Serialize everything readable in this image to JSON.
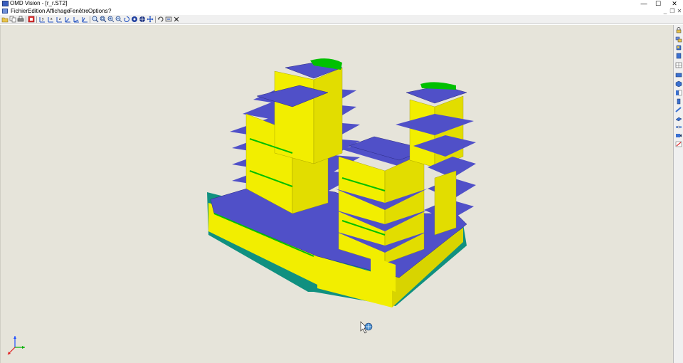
{
  "window": {
    "title": "OMD Vision - [r_r.ST2]",
    "controls": {
      "minimize": "—",
      "maximize": "☐",
      "close": "✕"
    }
  },
  "menu": {
    "items": [
      "Fichier",
      "Edition",
      "Affichage",
      "Fenêtre",
      "Options",
      "?"
    ],
    "mdi_controls": {
      "minimize": "_",
      "restore": "❐",
      "close": "✕"
    }
  },
  "toolbar": {
    "groups": [
      [
        "open-icon",
        "copy-icon",
        "print-icon"
      ],
      [
        "stop-icon"
      ],
      [
        "axis-y-icon",
        "axis-x-icon",
        "axis-z-icon",
        "axis-xy-icon",
        "axis-yz-icon",
        "axis-xz-icon"
      ],
      [
        "zoom-icon",
        "zoom-window-icon",
        "zoom-in-icon",
        "zoom-out-icon",
        "rotate-icon",
        "view-icon",
        "camera-icon",
        "move-icon"
      ],
      [
        "undo-icon",
        "export-icon",
        "settings-icon"
      ]
    ]
  },
  "right_panel": {
    "tools": [
      "lock-icon",
      "layers-icon",
      "cube-icon",
      "toggle-icon",
      "grid-icon",
      "render-icon",
      "solid-icon",
      "wall-icon",
      "column-icon",
      "beam-icon",
      "slab-icon",
      "section-icon",
      "camera-view-icon",
      "warning-icon"
    ]
  },
  "colors": {
    "viewport_bg": "#e6e4da",
    "wall": "#f2ee00",
    "slab": "#5050c8",
    "beam": "#00c000",
    "foundation": "#109080"
  }
}
